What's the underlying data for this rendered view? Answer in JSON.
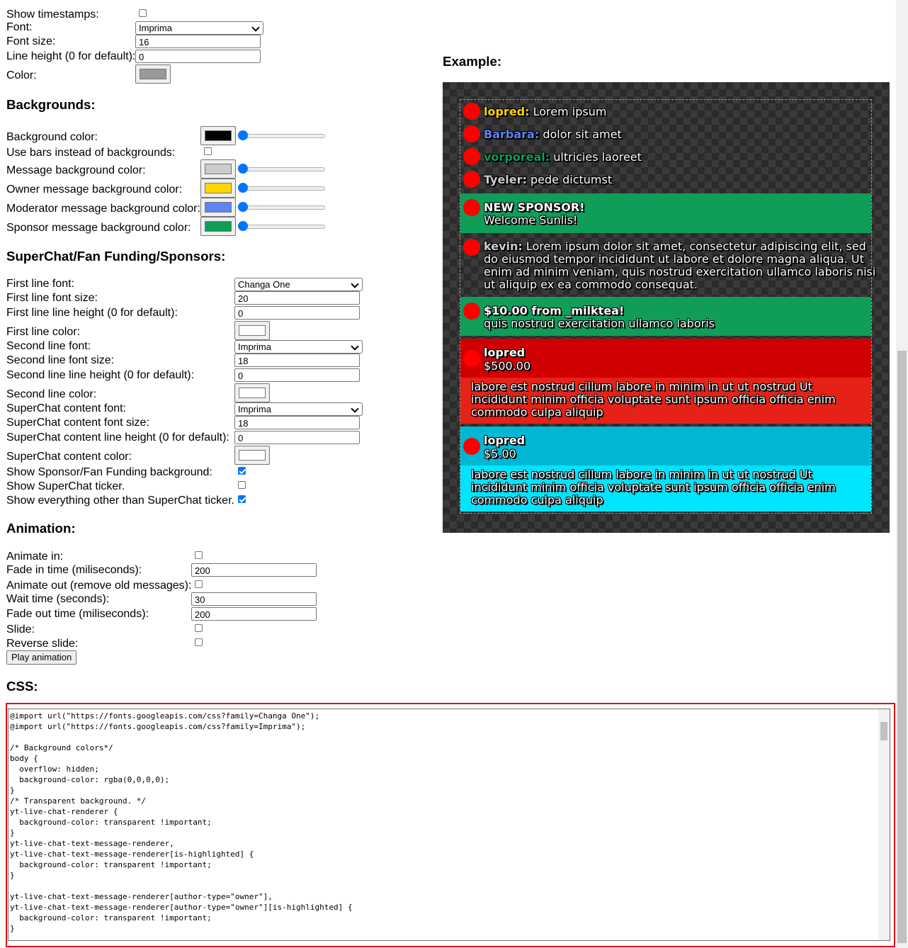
{
  "settings": {
    "show_timestamps_label": "Show timestamps:",
    "font_label": "Font:",
    "font_value": "Imprima",
    "font_size_label": "Font size:",
    "font_size_value": "16",
    "line_height_label": "Line height (0 for default):",
    "line_height_value": "0",
    "color_label": "Color:",
    "color_value": "#999999"
  },
  "backgrounds": {
    "heading": "Backgrounds:",
    "background_color_label": "Background color:",
    "background_color": "#000000",
    "use_bars_label": "Use bars instead of backgrounds:",
    "message_bg_label": "Message background color:",
    "message_bg": "#cccccc",
    "owner_bg_label": "Owner message background color:",
    "owner_bg": "#ffd600",
    "moderator_bg_label": "Moderator message background color:",
    "moderator_bg": "#5e84f1",
    "sponsor_bg_label": "Sponsor message background color:",
    "sponsor_bg": "#0f9d58"
  },
  "superchat": {
    "heading": "SuperChat/Fan Funding/Sponsors:",
    "first_line_font_label": "First line font:",
    "first_line_font": "Changa One",
    "first_line_font_size_label": "First line font size:",
    "first_line_font_size": "20",
    "first_line_line_height_label": "First line line height (0 for default):",
    "first_line_line_height": "0",
    "first_line_color_label": "First line color:",
    "second_line_font_label": "Second line font:",
    "second_line_font": "Imprima",
    "second_line_font_size_label": "Second line font size:",
    "second_line_font_size": "18",
    "second_line_line_height_label": "Second line line height (0 for default):",
    "second_line_line_height": "0",
    "second_line_color_label": "Second line color:",
    "content_font_label": "SuperChat content font:",
    "content_font": "Imprima",
    "content_font_size_label": "SuperChat content font size:",
    "content_font_size": "18",
    "content_line_height_label": "SuperChat content line height (0 for default):",
    "content_line_height": "0",
    "content_color_label": "SuperChat content color:",
    "show_sponsor_bg_label": "Show Sponsor/Fan Funding background:",
    "show_ticker_label": "Show SuperChat ticker.",
    "show_other_label": "Show everything other than SuperChat ticker."
  },
  "animation": {
    "heading": "Animation:",
    "animate_in_label": "Animate in:",
    "fade_in_label": "Fade in time (miliseconds):",
    "fade_in_value": "200",
    "animate_out_label": "Animate out (remove old messages):",
    "wait_time_label": "Wait time (seconds):",
    "wait_time_value": "30",
    "fade_out_label": "Fade out time (miliseconds):",
    "fade_out_value": "200",
    "slide_label": "Slide:",
    "reverse_slide_label": "Reverse slide:",
    "play_button": "Play animation"
  },
  "css": {
    "heading": "CSS:",
    "code": "@import url(\"https://fonts.googleapis.com/css?family=Changa One\");\n@import url(\"https://fonts.googleapis.com/css?family=Imprima\");\n\n/* Background colors*/\nbody {\n  overflow: hidden;\n  background-color: rgba(0,0,0,0);\n}\n/* Transparent background. */\nyt-live-chat-renderer {\n  background-color: transparent !important;\n}\nyt-live-chat-text-message-renderer,\nyt-live-chat-text-message-renderer[is-highlighted] {\n  background-color: transparent !important;\n}\n\nyt-live-chat-text-message-renderer[author-type=\"owner\"],\nyt-live-chat-text-message-renderer[author-type=\"owner\"][is-highlighted] {\n  background-color: transparent !important;\n}"
  },
  "example": {
    "heading": "Example:",
    "messages": [
      {
        "name": "lopred:",
        "text": "Lorem ipsum",
        "name_color": "#ffd600"
      },
      {
        "name": "Barbara:",
        "text": "dolor sit amet",
        "name_color": "#5e84f1"
      },
      {
        "name": "vorporeal:",
        "text": "ultricies laoreet",
        "name_color": "#0f9d58"
      },
      {
        "name": "Tyeler:",
        "text": "pede dictumst",
        "name_color": "#cccccc"
      }
    ],
    "sponsor": {
      "title": "NEW SPONSOR!",
      "text": "Welcome Sunlis!"
    },
    "kevin": {
      "name": "kevin:",
      "lines": [
        "Lorem ipsum dolor sit amet, consectetur adipiscing elit, sed",
        "do eiusmod tempor incididunt ut labore et dolore magna aliqua. Ut",
        "enim ad minim veniam, quis nostrud exercitation ullamco laboris nisi",
        "ut aliquip ex ea commodo consequat."
      ]
    },
    "fan_funding": {
      "title": "$10.00 from _milktea!",
      "text": "quis nostrud exercitation ullamco laboris"
    },
    "superchats": [
      {
        "name": "lopred",
        "amount": "$500.00",
        "header_color": "#d00000",
        "body_color": "#e62117",
        "lines": [
          "labore est nostrud cillum labore in minim in ut ut nostrud Ut",
          "incididunt minim officia voluptate sunt ipsum officia officia enim",
          "commodo culpa aliquip"
        ]
      },
      {
        "name": "lopred",
        "amount": "$5.00",
        "header_color": "#00b8d4",
        "body_color": "#00e5ff",
        "lines": [
          "labore est nostrud cillum labore in minim in ut ut nostrud Ut",
          "incididunt minim officia voluptate sunt ipsum officia officia enim",
          "commodo culpa aliquip"
        ]
      }
    ]
  }
}
